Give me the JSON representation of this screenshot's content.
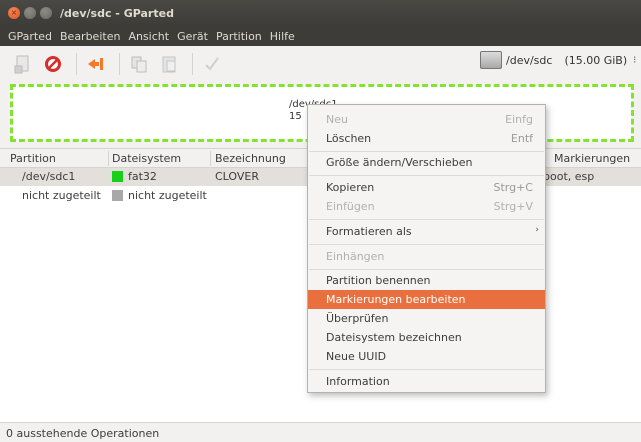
{
  "window": {
    "title": "/dev/sdc - GParted"
  },
  "menubar": [
    "GParted",
    "Bearbeiten",
    "Ansicht",
    "Gerät",
    "Partition",
    "Hilfe"
  ],
  "toolbar": {
    "icons": [
      "new-partition-icon",
      "delete-icon",
      "resize-move-icon",
      "copy-icon",
      "paste-icon",
      "apply-icon"
    ]
  },
  "device": {
    "name": "/dev/sdc",
    "size": "(15.00 GiB)"
  },
  "partition_map": {
    "label": "/dev/sdc1",
    "size_partial": "15"
  },
  "table": {
    "columns": [
      "Partition",
      "Dateisystem",
      "Bezeichnung",
      "Markierungen"
    ],
    "rows": [
      {
        "partition": "/dev/sdc1",
        "filesystem": "fat32",
        "label": "CLOVER",
        "flags": "boot, esp",
        "fs_color": "#18d018",
        "selected": true
      },
      {
        "partition": "nicht zugeteilt",
        "filesystem": "nicht zugeteilt",
        "label": "",
        "flags": "",
        "fs_color": "#a8a8a8",
        "selected": false
      }
    ]
  },
  "status": {
    "text": "0 ausstehende Operationen"
  },
  "context_menu": {
    "items": [
      {
        "label": "Neu",
        "accel": "Einfg",
        "disabled": true
      },
      {
        "label": "Löschen",
        "accel": "Entf",
        "disabled": false
      },
      {
        "label": "Größe ändern/Verschieben",
        "accel": "",
        "disabled": false
      },
      {
        "label": "Kopieren",
        "accel": "Strg+C",
        "disabled": false
      },
      {
        "label": "Einfügen",
        "accel": "Strg+V",
        "disabled": true
      },
      {
        "label": "Formatieren als",
        "accel": "",
        "disabled": false,
        "submenu": true
      },
      {
        "label": "Einhängen",
        "accel": "",
        "disabled": true
      },
      {
        "label": "Partition benennen",
        "accel": "",
        "disabled": false
      },
      {
        "label": "Markierungen bearbeiten",
        "accel": "",
        "disabled": false,
        "highlighted": true
      },
      {
        "label": "Überprüfen",
        "accel": "",
        "disabled": false
      },
      {
        "label": "Dateisystem bezeichnen",
        "accel": "",
        "disabled": false
      },
      {
        "label": "Neue UUID",
        "accel": "",
        "disabled": false
      },
      {
        "label": "Information",
        "accel": "",
        "disabled": false
      }
    ]
  },
  "colors": {
    "accent": "#e9703e",
    "map_border": "#83e32e",
    "titlebar": "#3d3c38"
  }
}
